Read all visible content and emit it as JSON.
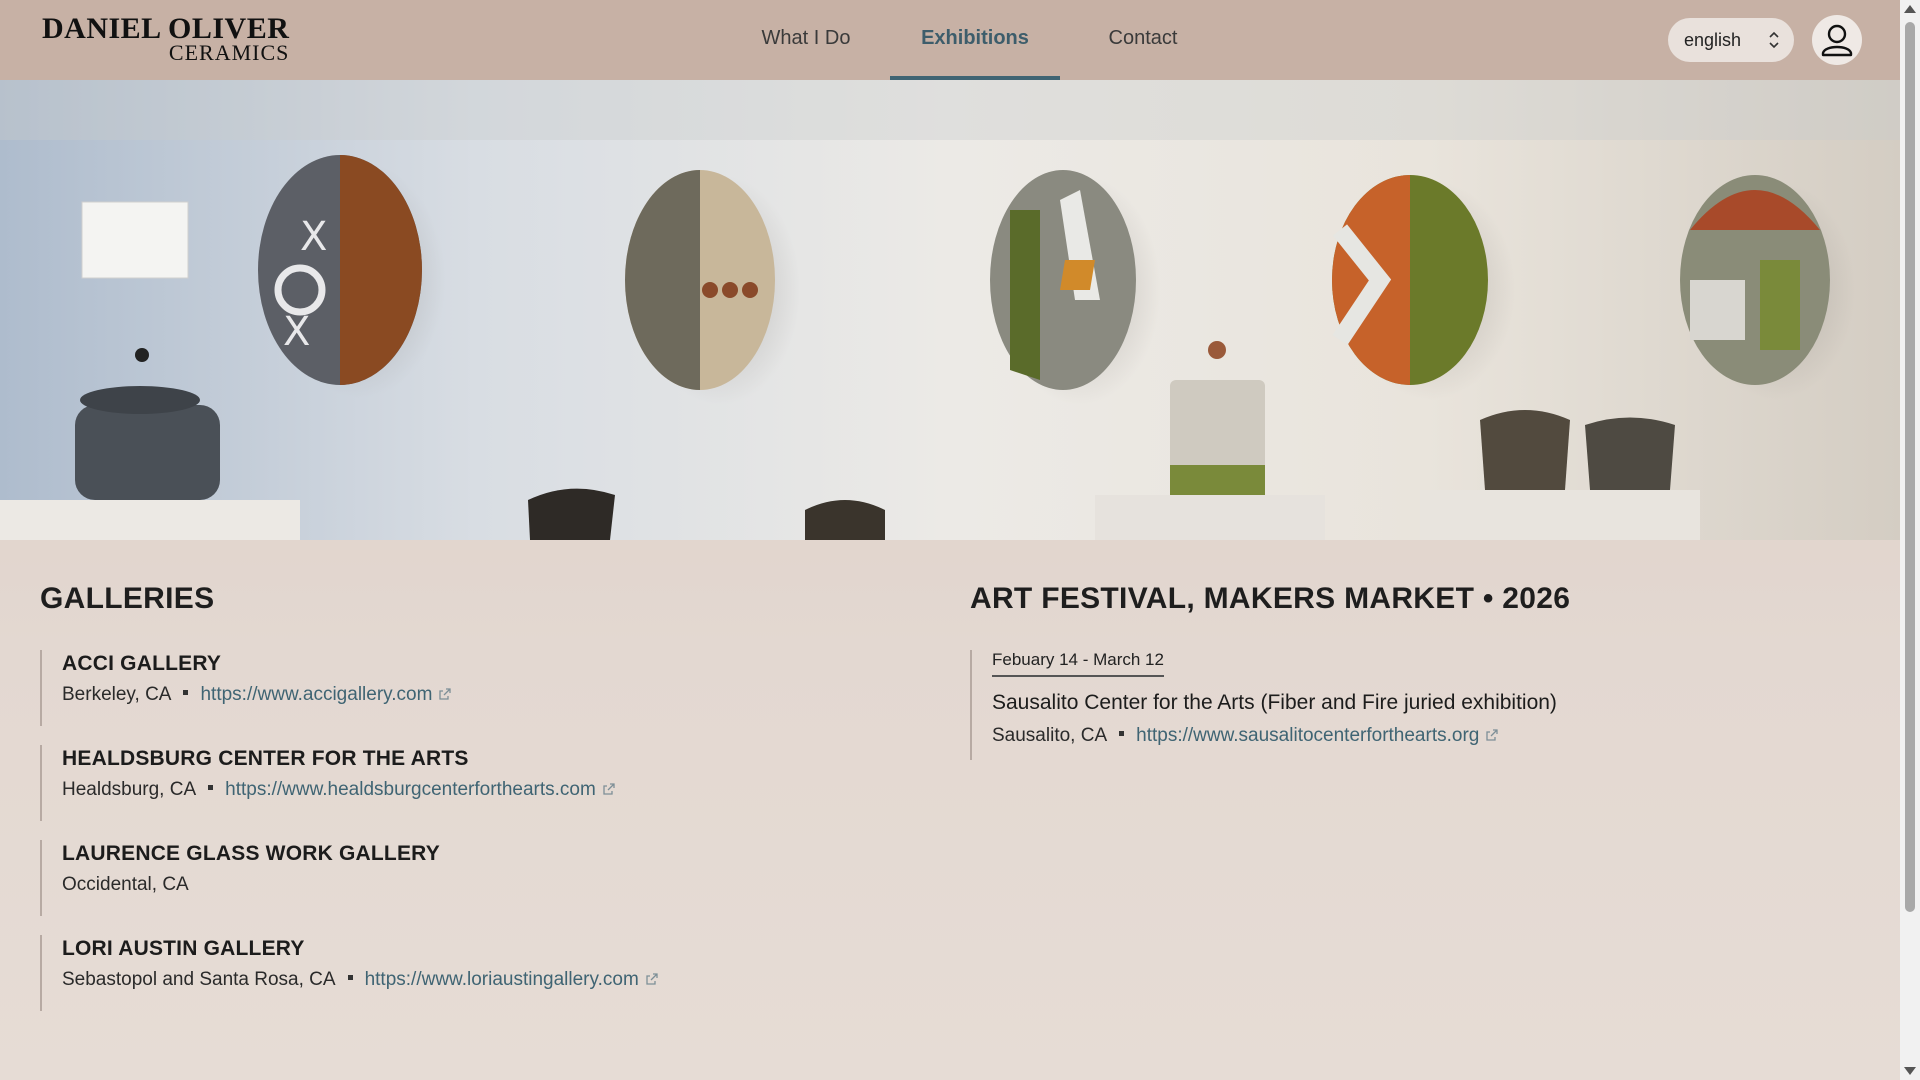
{
  "logo": {
    "line1": "DANIEL OLIVER",
    "line2": "CERAMICS"
  },
  "nav": {
    "items": [
      {
        "label": "What I Do"
      },
      {
        "label": "Exhibitions",
        "active": true
      },
      {
        "label": "Contact"
      }
    ]
  },
  "language": {
    "selected": "english"
  },
  "icons": {
    "user": "user-icon",
    "external": "external-link-icon"
  },
  "colors": {
    "header": "#c7b1a5",
    "accent": "#3f6473",
    "background": "#e3d8d1"
  },
  "galleries": {
    "heading": "GALLERIES",
    "items": [
      {
        "name": "ACCI GALLERY",
        "location": "Berkeley, CA",
        "url": "https://www.accigallery.com"
      },
      {
        "name": "HEALDSBURG CENTER FOR THE ARTS",
        "location": "Healdsburg, CA",
        "url": "https://www.healdsburgcenterforthearts.com"
      },
      {
        "name": "LAURENCE GLASS WORK GALLERY",
        "location": "Occidental, CA"
      },
      {
        "name": "LORI AUSTIN GALLERY",
        "location": "Sebastopol and Santa Rosa, CA",
        "url": "https://www.loriaustingallery.com"
      }
    ]
  },
  "festival": {
    "heading": "ART FESTIVAL, MAKERS MARKET • 2026",
    "event": {
      "date": "Febuary 14 - March 12",
      "title": "Sausalito Center for the Arts (Fiber and Fire juried exhibition)",
      "location": "Sausalito, CA",
      "url": "https://www.sausalitocenterforthearts.org"
    }
  }
}
